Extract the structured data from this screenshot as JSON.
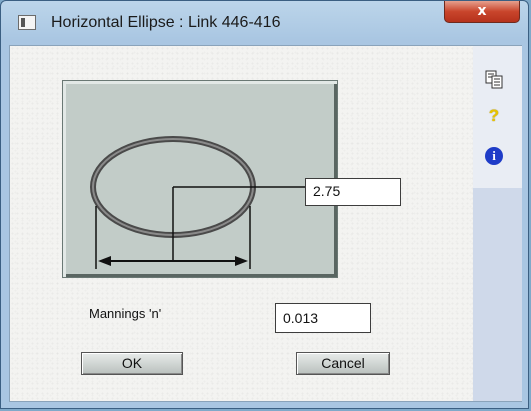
{
  "window": {
    "title": "Horizontal Ellipse  : Link 446-416",
    "close_label": "x"
  },
  "toolbar": {
    "icons": [
      "copy-icon",
      "help-icon",
      "info-icon"
    ],
    "help_glyph": "?",
    "info_glyph": "i"
  },
  "diagram": {
    "width_value": "2.75"
  },
  "form": {
    "mannings_label": "Mannings 'n'",
    "mannings_value": "0.013"
  },
  "buttons": {
    "ok_label": "OK",
    "cancel_label": "Cancel"
  },
  "colors": {
    "close_button": "#c9452c",
    "diagram_background": "#c2ccc8",
    "info_icon": "#1e3cc8",
    "help_icon": "#e8c400"
  }
}
